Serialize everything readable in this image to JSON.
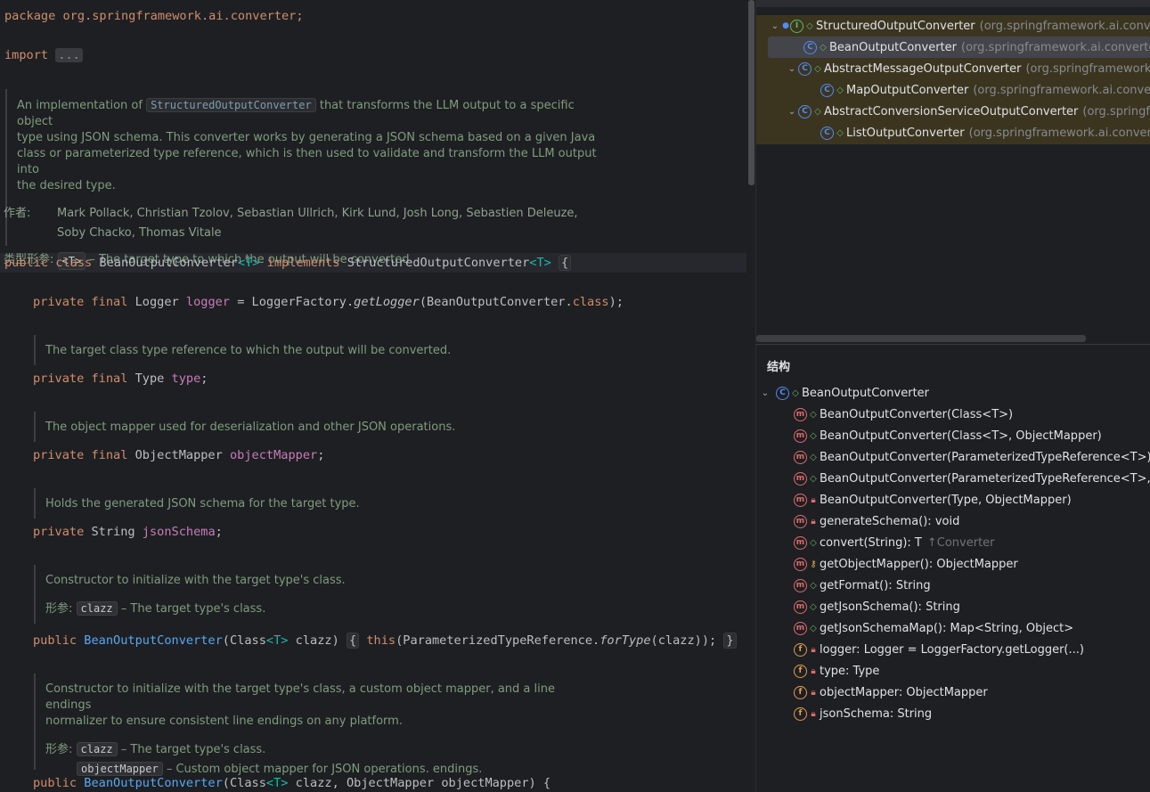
{
  "editor": {
    "package_line": "package org.springframework.ai.converter;",
    "import_kw": "import",
    "import_fold": "...",
    "class_doc": {
      "text_before": "An implementation of",
      "text_code": "StructuredOutputConverter",
      "text_after_line1": "that transforms the LLM output to a specific object",
      "text_lines": [
        "type using JSON schema. This converter works by generating a JSON schema based on a given Java",
        "class or parameterized type reference, which is then used to validate and transform the LLM output into",
        "the desired type."
      ],
      "author_label": "作者:",
      "authors_line1": "Mark Pollack, Christian Tzolov, Sebastian Ullrich, Kirk Lund, Josh Long, Sebastien Deleuze,",
      "authors_line2": "Soby Chacko, Thomas Vitale",
      "typeparam_label": "类型形参:",
      "typeparam_chip": "<T>",
      "typeparam_desc": "– The target type to which the output will be converted."
    },
    "class_decl": {
      "kw1": "public",
      "kw2": "class",
      "name": "BeanOutputConverter",
      "tparam": "<T>",
      "kw3": "implements",
      "iface": "StructuredOutputConverter",
      "tparam2": "<T>",
      "brace": "{"
    },
    "logger_line": {
      "kw": "private final",
      "type": "Logger",
      "field": "logger",
      "eq": "= LoggerFactory.",
      "method": "getLogger",
      "arg": "(BeanOutputConverter.",
      "cls": "class",
      "end": ");"
    },
    "doc_type": "The target class type reference to which the output will be converted.",
    "type_line": {
      "kw": "private final",
      "type": "Type",
      "field": "type",
      "end": ";"
    },
    "doc_mapper": "The object mapper used for deserialization and other JSON operations.",
    "mapper_line": {
      "kw": "private final",
      "type": "ObjectMapper",
      "field": "objectMapper",
      "end": ";"
    },
    "doc_schema": "Holds the generated JSON schema for the target type.",
    "schema_line": {
      "kw": "private",
      "type": "String",
      "field": "jsonSchema",
      "end": ";"
    },
    "doc_ctor1": {
      "text": "Constructor to initialize with the target type's class.",
      "param_label": "形参:",
      "param_chip": "clazz",
      "param_desc": "– The target type's class."
    },
    "ctor1_line": {
      "kw": "public",
      "name": "BeanOutputConverter",
      "params_a": "(Class",
      "tp": "<T>",
      "params_b": "clazz)",
      "open": "{",
      "this_kw": "this",
      "body_a": "(ParameterizedTypeReference.",
      "body_method": "forType",
      "body_b": "(clazz));",
      "close": "}"
    },
    "doc_ctor2": {
      "line1": "Constructor to initialize with the target type's class, a custom object mapper, and a line endings",
      "line2": "normalizer to ensure consistent line endings on any platform.",
      "param_label": "形参:",
      "param1_chip": "clazz",
      "param1_desc": "– The target type's class.",
      "param2_chip": "objectMapper",
      "param2_desc": "– Custom object mapper for JSON operations. endings."
    },
    "ctor2_line": {
      "kw": "public",
      "name": "BeanOutputConverter",
      "params_a": "(Class",
      "tp": "<T>",
      "params_b": "clazz, ObjectMapper objectMapper) {"
    }
  },
  "hierarchy": {
    "items": [
      {
        "name": "StructuredOutputConverter",
        "pkg": "(org.springframework.ai.converter)",
        "kind": "I"
      },
      {
        "name": "BeanOutputConverter",
        "pkg": "(org.springframework.ai.converter)",
        "kind": "C"
      },
      {
        "name": "AbstractMessageOutputConverter",
        "pkg": "(org.springframework.ai.converter)",
        "kind": "C"
      },
      {
        "name": "MapOutputConverter",
        "pkg": "(org.springframework.ai.converter)",
        "kind": "C"
      },
      {
        "name": "AbstractConversionServiceOutputConverter",
        "pkg": "(org.springframework.ai.converter)",
        "kind": "C"
      },
      {
        "name": "ListOutputConverter",
        "pkg": "(org.springframework.ai.converter)",
        "kind": "C"
      }
    ]
  },
  "structure": {
    "title": "结构",
    "root": "BeanOutputConverter",
    "members": [
      {
        "label": "BeanOutputConverter(Class<T>)",
        "kind": "m",
        "vis": "public"
      },
      {
        "label": "BeanOutputConverter(Class<T>, ObjectMapper)",
        "kind": "m",
        "vis": "public"
      },
      {
        "label": "BeanOutputConverter(ParameterizedTypeReference<T>)",
        "kind": "m",
        "vis": "public"
      },
      {
        "label": "BeanOutputConverter(ParameterizedTypeReference<T>, ObjectMapper)",
        "kind": "m",
        "vis": "public"
      },
      {
        "label": "BeanOutputConverter(Type, ObjectMapper)",
        "kind": "m",
        "vis": "private"
      },
      {
        "label": "generateSchema(): void",
        "kind": "m",
        "vis": "private"
      },
      {
        "label": "convert(String): T",
        "extra": "↑Converter",
        "kind": "m",
        "vis": "public"
      },
      {
        "label": "getObjectMapper(): ObjectMapper",
        "kind": "m",
        "vis": "protected"
      },
      {
        "label": "getFormat(): String",
        "kind": "m",
        "vis": "public"
      },
      {
        "label": "getJsonSchema(): String",
        "kind": "m",
        "vis": "public"
      },
      {
        "label": "getJsonSchemaMap(): Map<String, Object>",
        "kind": "m",
        "vis": "public"
      },
      {
        "label": "logger: Logger = LoggerFactory.getLogger(...)",
        "kind": "f",
        "vis": "private"
      },
      {
        "label": "type: Type",
        "kind": "f",
        "vis": "private"
      },
      {
        "label": "objectMapper: ObjectMapper",
        "kind": "f",
        "vis": "private"
      },
      {
        "label": "jsonSchema: String",
        "kind": "f",
        "vis": "private"
      }
    ]
  }
}
